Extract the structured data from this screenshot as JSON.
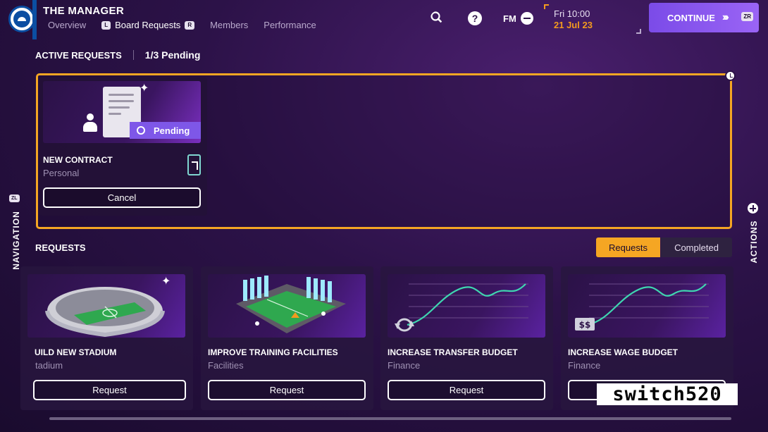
{
  "header": {
    "title": "THE MANAGER",
    "tabs": [
      {
        "label": "Overview",
        "active": false
      },
      {
        "label": "Board Requests",
        "active": true,
        "left_glyph": "L",
        "right_glyph": "R"
      },
      {
        "label": "Members",
        "active": false
      },
      {
        "label": "Performance",
        "active": false
      }
    ],
    "fm_label": "FM",
    "date_time": "Fri 10:00",
    "date_day": "21 Jul 23",
    "continue_label": "CONTINUE",
    "continue_glyph": "ZR",
    "icons": [
      "club-badge",
      "search-icon",
      "help-icon",
      "minus-icon"
    ]
  },
  "active_requests": {
    "title": "ACTIVE REQUESTS",
    "count": "1/3 Pending",
    "card": {
      "title": "NEW CONTRACT",
      "subtitle": "Personal",
      "status": "Pending",
      "cancel_label": "Cancel"
    }
  },
  "requests": {
    "title": "REQUESTS",
    "toggle": {
      "active": "Requests",
      "inactive": "Completed"
    },
    "cards": [
      {
        "title": "UILD NEW STADIUM",
        "subtitle": "tadium",
        "button": "Request"
      },
      {
        "title": "IMPROVE TRAINING FACILITIES",
        "subtitle": "Facilities",
        "button": "Request"
      },
      {
        "title": "INCREASE TRANSFER BUDGET",
        "subtitle": "Finance",
        "button": "Request"
      },
      {
        "title": "INCREASE WAGE BUDGET",
        "subtitle": "Finance",
        "button": "Request"
      }
    ]
  },
  "side": {
    "left_label": "NAVIGATION",
    "left_glyph": "ZL",
    "right_label": "ACTIONS"
  },
  "colors": {
    "accent_orange": "#f5a623",
    "accent_purple": "#7e57e8",
    "chart_line": "#3fd6b0",
    "background": "#2c1248"
  },
  "watermark": "switch520"
}
